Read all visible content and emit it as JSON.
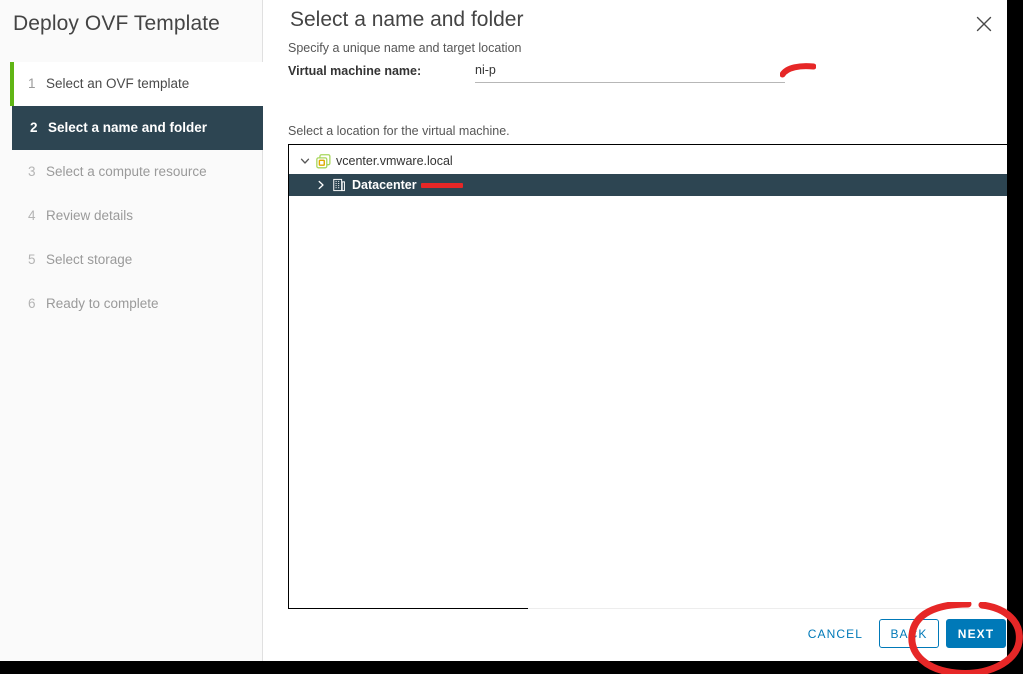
{
  "window": {
    "wizard_title": "Deploy OVF Template"
  },
  "sidebar": {
    "steps": [
      {
        "num": "1",
        "label": "Select an OVF template",
        "state": "done"
      },
      {
        "num": "2",
        "label": "Select a name and folder",
        "state": "active"
      },
      {
        "num": "3",
        "label": "Select a compute resource",
        "state": "pending"
      },
      {
        "num": "4",
        "label": "Review details",
        "state": "pending"
      },
      {
        "num": "5",
        "label": "Select storage",
        "state": "pending"
      },
      {
        "num": "6",
        "label": "Ready to complete",
        "state": "pending"
      }
    ]
  },
  "content": {
    "page_title": "Select a name and folder",
    "subtitle": "Specify a unique name and target location",
    "vm_name_label": "Virtual machine name:",
    "vm_name_value": "ni-p",
    "vm_name_placeholder": "",
    "location_label": "Select a location for the virtual machine.",
    "close_icon": "close-icon"
  },
  "tree": {
    "nodes": [
      {
        "label": "vcenter.vmware.local",
        "icon": "vcenter-server-icon",
        "twisty": "chevron-down-icon",
        "expanded": true,
        "selected": false
      },
      {
        "label": "Datacenter",
        "icon": "datacenter-icon",
        "twisty": "chevron-right-icon",
        "expanded": false,
        "selected": true
      }
    ]
  },
  "footer": {
    "cancel_label": "CANCEL",
    "back_label": "BACK",
    "next_label": "NEXT"
  },
  "annotations": {
    "name_mark": "red-stroke-mark",
    "datacenter_mark": "red-underline-mark",
    "next_circle": "red-circle-highlight"
  },
  "colors": {
    "accent_blue": "#0079b8",
    "active_step_bg": "#2d4552",
    "done_step_bar": "#60b515",
    "annotation_red": "#e62727",
    "sidebar_bg": "#fafafa"
  }
}
